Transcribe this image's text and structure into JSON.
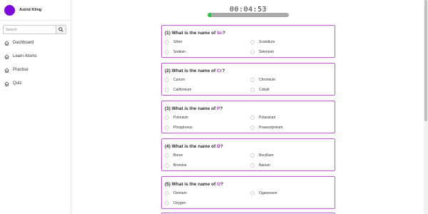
{
  "user": {
    "name": "Astrid Kling"
  },
  "search": {
    "placeholder": "Search"
  },
  "nav": [
    {
      "label": "Dashboard"
    },
    {
      "label": "Learn Atoms"
    },
    {
      "label": "Practise"
    },
    {
      "label": "Quiz"
    }
  ],
  "timer": {
    "text": "00:04:53",
    "progress_fraction": 0.04
  },
  "questions": [
    {
      "prefix": "(1) What is the name of ",
      "symbol": "Sc",
      "suffix": "?",
      "options": [
        "Silver",
        "Scandium",
        "Sodium",
        "Selenium"
      ]
    },
    {
      "prefix": "(2) What is the name of ",
      "symbol": "Cr",
      "suffix": "?",
      "options": [
        "Curium",
        "Chromium",
        "Californium",
        "Cobalt"
      ]
    },
    {
      "prefix": "(3) What is the name of ",
      "symbol": "P",
      "suffix": "?",
      "options": [
        "Polonium",
        "Potassium",
        "Phosphorus",
        "Praseodymium"
      ]
    },
    {
      "prefix": "(4) What is the name of ",
      "symbol": "B",
      "suffix": "?",
      "options": [
        "Boron",
        "Beryllium",
        "Bromine",
        "Barium"
      ]
    },
    {
      "prefix": "(5) What is the name of ",
      "symbol": "O",
      "suffix": "?",
      "options": [
        "Osmium",
        "Oganesson",
        "Oxygen"
      ]
    }
  ],
  "colors": {
    "accent": "#b52bd0",
    "avatar": "#7a0bd9",
    "progress": "#25c93e",
    "card_border": "#c457d8"
  },
  "icons": {
    "search": "search-icon",
    "nav": "home-icon"
  }
}
